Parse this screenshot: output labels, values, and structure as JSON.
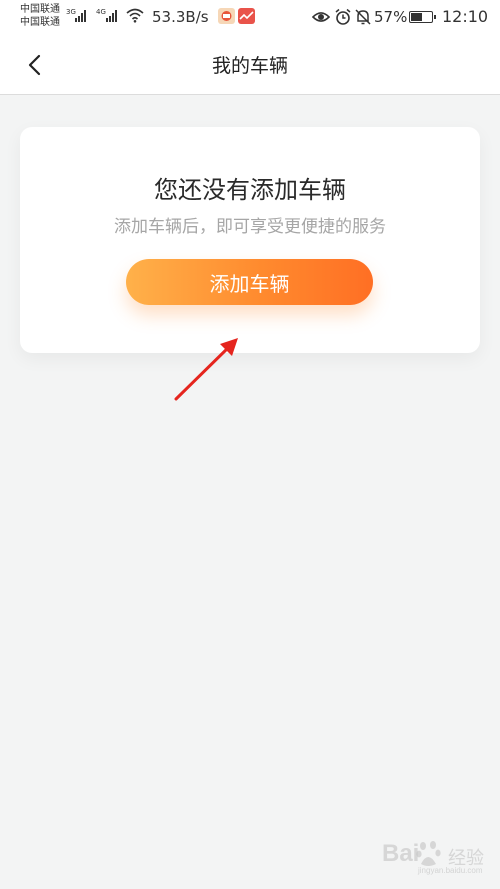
{
  "status_bar": {
    "carrier_1": "中国联通",
    "carrier_2": "中国联通",
    "network_1": "3G",
    "network_2": "4G",
    "net_speed": "53.3B/s",
    "battery_percent": "57%",
    "battery_level": 0.57,
    "time": "12:10",
    "icons": [
      "signal-bars-icon",
      "wifi-icon",
      "app-notification-icon",
      "eye-comfort-icon",
      "alarm-icon",
      "mute-bell-icon",
      "battery-icon"
    ]
  },
  "nav": {
    "title": "我的车辆",
    "back_icon": "chevron-left-icon"
  },
  "empty_state": {
    "title": "您还没有添加车辆",
    "subtitle": "添加车辆后，即可享受更便捷的服务",
    "button_label": "添加车辆"
  },
  "annotation": {
    "arrow_color": "#e5251e",
    "arrow_icon": "annotation-arrow-icon"
  },
  "watermark": {
    "brand": "Bai",
    "brand_cn": "经验",
    "url": "jingyan.baidu.com"
  },
  "colors": {
    "background": "#f3f4f4",
    "card": "#ffffff",
    "button_gradient_start": "#ffb14a",
    "button_gradient_end": "#ff6f24",
    "subtitle": "#a6a6a6"
  }
}
